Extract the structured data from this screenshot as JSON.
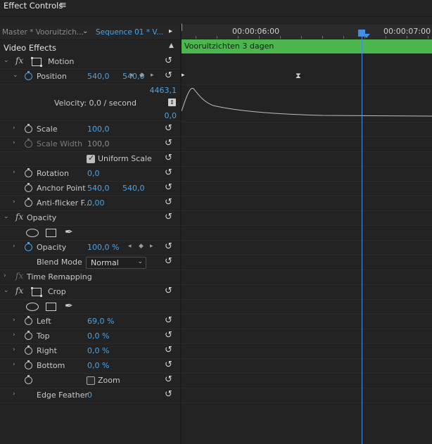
{
  "panel": {
    "title": "Effect Controls",
    "menu_icon": "hamburger-menu-icon"
  },
  "source": {
    "master_label": "Master * Vooruitzich...",
    "sequence_label": "Sequence 01 * V...",
    "chevron": "⌄",
    "play": "▸"
  },
  "ruler": {
    "labels": [
      "00:00:06:00",
      "00:00:07:00"
    ]
  },
  "clip": {
    "name": "Vooruitzichten 3 dagen",
    "color": "#4bb54e"
  },
  "playhead": {
    "color": "#3f90e6"
  },
  "video_effects": {
    "label": "Video Effects"
  },
  "motion": {
    "label": "Motion",
    "position": {
      "label": "Position",
      "x": "540,0",
      "y": "540,0"
    },
    "velocity": {
      "label": "Velocity: 0,0 / second",
      "max": "4463,1",
      "min": "0,0"
    },
    "scale": {
      "label": "Scale",
      "value": "100,0"
    },
    "scale_width": {
      "label": "Scale Width",
      "value": "100,0"
    },
    "uniform_scale": {
      "label": "Uniform Scale",
      "checked": true
    },
    "rotation": {
      "label": "Rotation",
      "value": "0,0"
    },
    "anchor_point": {
      "label": "Anchor Point",
      "x": "540,0",
      "y": "540,0"
    },
    "anti_flicker": {
      "label": "Anti-flicker F...",
      "value": "0,00"
    }
  },
  "opacity": {
    "label": "Opacity",
    "opacity": {
      "label": "Opacity",
      "value": "100,0 %"
    },
    "blend_mode": {
      "label": "Blend Mode",
      "value": "Normal"
    }
  },
  "time_remapping": {
    "label": "Time Remapping"
  },
  "crop": {
    "label": "Crop",
    "left": {
      "label": "Left",
      "value": "69,0 %"
    },
    "top": {
      "label": "Top",
      "value": "0,0 %"
    },
    "right": {
      "label": "Right",
      "value": "0,0 %"
    },
    "bottom": {
      "label": "Bottom",
      "value": "0,0 %"
    },
    "zoom": {
      "label": "Zoom",
      "checked": false
    },
    "edge_feather": {
      "label": "Edge Feather",
      "value": "0"
    }
  },
  "glyphs": {
    "twist_open": "⌄",
    "twist_closed": "›",
    "fx": "fx",
    "reset": "↺",
    "kf_prev": "◂",
    "kf_add": "◆",
    "kf_next": "▸",
    "up": "▲",
    "pen": "✒",
    "hourglass": "⧗",
    "select_arrow": "⌄"
  }
}
